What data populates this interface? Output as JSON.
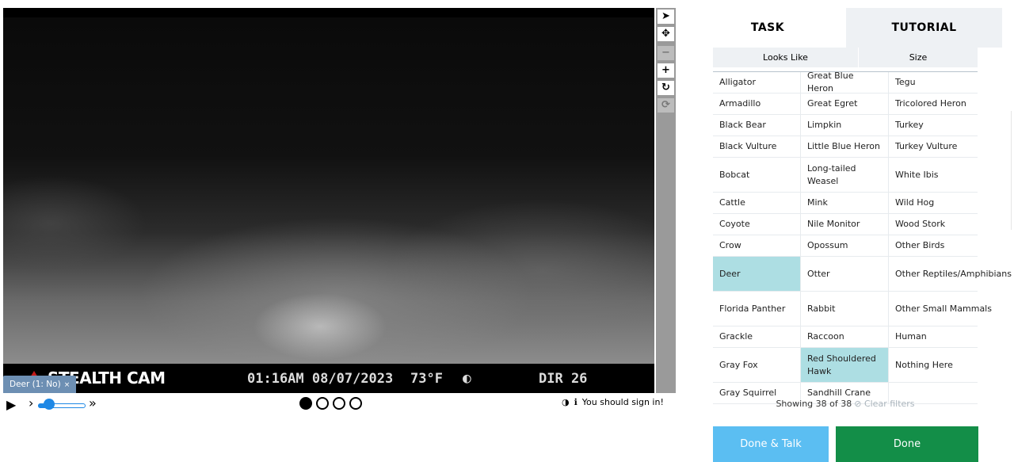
{
  "viewer": {
    "camera_brand": "STEALTH CAM",
    "time": "01:16AM",
    "date": "08/07/2023",
    "temperature": "73°F",
    "moon_icon": "◐",
    "direction": "DIR 26",
    "annotation_tag": "Deer (1: No)",
    "annotation_close": "×",
    "toolbar": {
      "pointer": "➤",
      "move": "✥",
      "zoom_out": "−",
      "zoom_in": "+",
      "rotate": "↻",
      "reset": "⟳"
    },
    "controls": {
      "play": "▶",
      "slower": "›",
      "faster": "»",
      "rate_level": 0.15
    },
    "frames": [
      true,
      false,
      false,
      false
    ],
    "contrast_icon": "◑",
    "info_icon": "ℹ",
    "signin_text": "You should sign in!"
  },
  "panel": {
    "tabs": [
      {
        "label": "TASK",
        "active": true
      },
      {
        "label": "TUTORIAL",
        "active": false
      }
    ],
    "filters": [
      {
        "label": "Looks Like"
      },
      {
        "label": "Size"
      }
    ],
    "choices": [
      [
        "Alligator",
        "Great Blue Heron",
        "Tegu"
      ],
      [
        "Armadillo",
        "Great Egret",
        "Tricolored Heron"
      ],
      [
        "Black Bear",
        "Limpkin",
        "Turkey"
      ],
      [
        "Black Vulture",
        "Little Blue Heron",
        "Turkey Vulture"
      ],
      [
        "Bobcat",
        "Long-tailed Weasel",
        "White Ibis"
      ],
      [
        "Cattle",
        "Mink",
        "Wild Hog"
      ],
      [
        "Coyote",
        "Nile Monitor",
        "Wood Stork"
      ],
      [
        "Crow",
        "Opossum",
        "Other Birds"
      ],
      [
        "Deer",
        "Otter",
        "Other Reptiles/Amphibians"
      ],
      [
        "Florida Panther",
        "Rabbit",
        "Other Small Mammals"
      ],
      [
        "Grackle",
        "Raccoon",
        "Human"
      ],
      [
        "Gray Fox",
        "Red Shouldered Hawk",
        "Nothing Here"
      ],
      [
        "Gray Squirrel",
        "Sandhill Crane",
        ""
      ]
    ],
    "selected": [
      "Deer",
      "Red Shouldered Hawk"
    ],
    "showing_text": "Showing 38 of 38",
    "clear_filters": "⊘ Clear filters",
    "done_talk_label": "Done & Talk",
    "done_label": "Done"
  },
  "colors": {
    "selected_bg": "#addee3",
    "done_talk": "#5bbef2",
    "done": "#138e48",
    "annotation_tag": "#6d8fb3",
    "slider": "#1e88e5"
  }
}
